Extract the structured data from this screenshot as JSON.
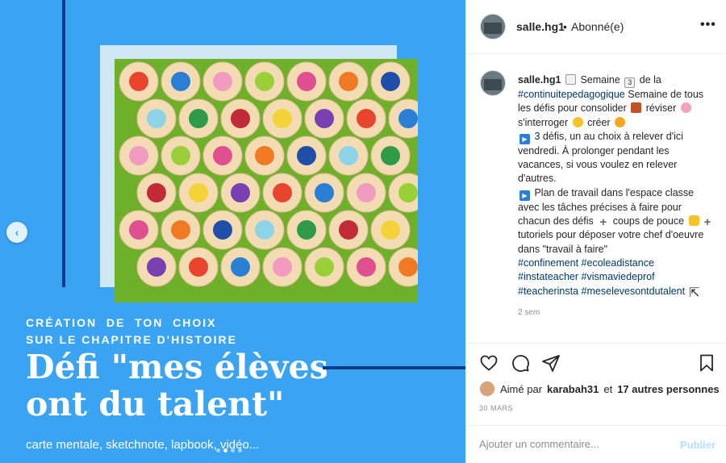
{
  "post_image": {
    "caption_line1": "CRÉATION  DE  TON  CHOIX",
    "caption_line2": "SUR LE CHAPITRE D'HISTOIRE",
    "title_line1": "Défi \"mes élèves",
    "title_line2": "ont du talent\"",
    "subline": "carte mentale, sketchnote, lapbook, vidéo...",
    "bg_color": "#3aa3f2",
    "accent_color": "#0f3a8c"
  },
  "header": {
    "username": "salle.hg1",
    "separator": "•",
    "status": "Abonné(e)"
  },
  "comment": {
    "username": "salle.hg1",
    "t1": " Semaine ",
    "t2": " de la ",
    "h1": "#continuitepedagogique",
    "t3": " Semaine de tous les défis pour consolider ",
    "t4": " réviser ",
    "t5": " s'interroger ",
    "t6": " créer ",
    "t7": " 3 défis, un au choix à relever d'ici vendredi. À prolonger pendant les vacances, si vous voulez en relever d'autres.",
    "t8": " Plan de travail dans l'espace classe avec les tâches précises à faire pour chacun des défis ",
    "t9": " coups de pouce ",
    "t10": " tutoriels pour déposer votre chef d'oeuvre dans \"travail à faire\"",
    "hashtags": [
      "#confinement",
      "#ecoleadistance",
      "#instateacher",
      "#vismaviedeprof",
      "#teacherinsta",
      "#meselevesontdutalent"
    ],
    "time_ago": "2 sem"
  },
  "likes": {
    "prefix": "Aimé par",
    "user": "karabah31",
    "middle": "et",
    "others": "17 autres personnes"
  },
  "date": "30 MARS",
  "add_comment": {
    "placeholder": "Ajouter un commentaire...",
    "publish": "Publier"
  }
}
